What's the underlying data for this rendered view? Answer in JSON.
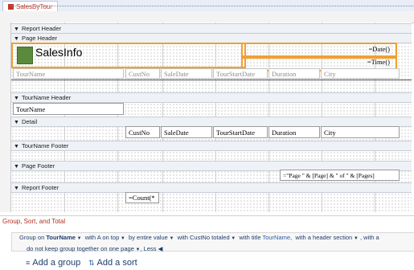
{
  "tab": {
    "title": "SalesByTour"
  },
  "sections": {
    "report_header": "Report Header",
    "page_header": "Page Header",
    "tourname_header": "TourName Header",
    "detail": "Detail",
    "tourname_footer": "TourName Footer",
    "page_footer": "Page Footer",
    "report_footer": "Report Footer"
  },
  "page_header": {
    "title": "SalesInfo",
    "date_expr": "=Date()",
    "time_expr": "=Time()",
    "labels": [
      "TourName",
      "CustNo",
      "SaleDate",
      "TourStartDate",
      "Duration",
      "City"
    ]
  },
  "tourname_header": {
    "field": "TourName"
  },
  "detail": {
    "fields": [
      "CustNo",
      "SaleDate",
      "TourStartDate",
      "Duration",
      "City"
    ]
  },
  "page_footer": {
    "expr": "=\"Page \" & [Page] & \" of \" & [Pages]"
  },
  "report_footer": {
    "expr": "=Count(*"
  },
  "group_pane": {
    "title": "Group, Sort, and Total",
    "line1": {
      "group_on": "Group on",
      "field": "TourName",
      "with_a_on_top": "with A on top",
      "by_entire_value": "by entire value",
      "with_custno_totaled": "with CustNo totaled",
      "with_title": "with title",
      "title_field": "TourName",
      "with_header": "with a header section",
      "with_a": "with a"
    },
    "line2": {
      "no_keep": "do not keep group together on one page",
      "less": "Less"
    },
    "add_group": "Add a group",
    "add_sort": "Add a sort"
  }
}
